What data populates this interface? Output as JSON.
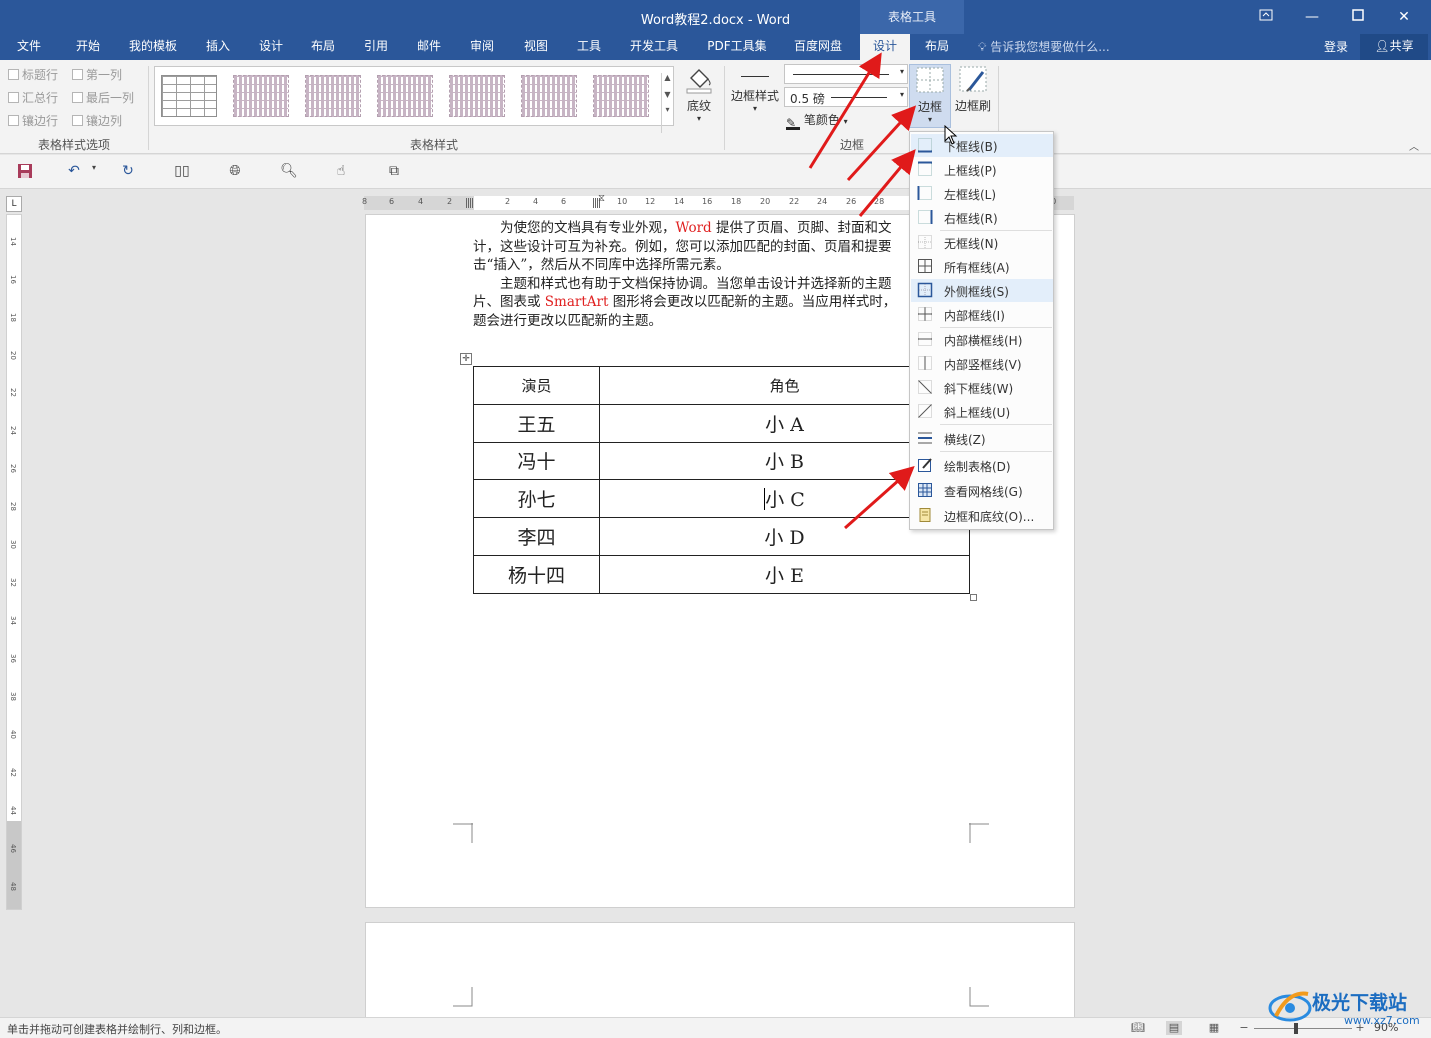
{
  "window": {
    "title": "Word教程2.docx - Word",
    "context_tab_header": "表格工具",
    "controls": [
      "ribbon-display-icon",
      "minimize-icon",
      "maximize-icon",
      "close-icon"
    ]
  },
  "tabs": [
    "文件",
    "开始",
    "我的模板",
    "插入",
    "设计",
    "布局",
    "引用",
    "邮件",
    "审阅",
    "视图",
    "工具",
    "开发工具",
    "PDF工具集",
    "百度网盘",
    "设计",
    "布局"
  ],
  "active_tab_index": 14,
  "tell_me": "告诉我您想要做什么...",
  "login": "登录",
  "share": "共享",
  "ribbon": {
    "table_style_options": {
      "label": "表格样式选项",
      "checkboxes": [
        "标题行",
        "第一列",
        "汇总行",
        "最后一列",
        "镶边行",
        "镶边列"
      ]
    },
    "table_styles": {
      "label": "表格样式"
    },
    "shading": "底纹",
    "borders_group": {
      "label": "边框",
      "border_styles": "边框样式",
      "pen_weight": "0.5 磅",
      "pen_color": "笔颜色",
      "borders": "边框",
      "border_painter": "边框刷"
    }
  },
  "hruler_ticks": [
    "8",
    "6",
    "4",
    "2",
    "2",
    "4",
    "6",
    "10",
    "12",
    "14",
    "16",
    "18",
    "20",
    "22",
    "24",
    "26",
    "28",
    "30"
  ],
  "vruler_ticks": [
    "14",
    "16",
    "18",
    "20",
    "22",
    "24",
    "26",
    "28",
    "30",
    "32",
    "34",
    "36",
    "38",
    "40",
    "42",
    "44",
    "46",
    "48"
  ],
  "document": {
    "para1": [
      "为使您的文档具有专业外观，",
      "Word",
      " 提供了页眉、页脚、封面和文",
      "计，这些设计可互为补充。例如，您可以添加匹配的封面、页眉和提要",
      "击“插入”，然后从不同库中选择所需元素。"
    ],
    "para2": [
      "主题和样式也有助于文档保持协调。当您单击设计并选择新的主题",
      "片、图表或 ",
      "SmartArt",
      " 图形将会更改以匹配新的主题。当应用样式时，",
      "题会进行更改以匹配新的主题。"
    ],
    "table": {
      "headers": [
        "演员",
        "角色"
      ],
      "rows": [
        [
          "王五",
          "小 A"
        ],
        [
          "冯十",
          "小 B"
        ],
        [
          "孙七",
          "小 C"
        ],
        [
          "李四",
          "小 D"
        ],
        [
          "杨十四",
          "小 E"
        ]
      ]
    }
  },
  "border_menu": {
    "items": [
      "下框线(B)",
      "上框线(P)",
      "左框线(L)",
      "右框线(R)",
      "无框线(N)",
      "所有框线(A)",
      "外侧框线(S)",
      "内部框线(I)",
      "内部横框线(H)",
      "内部竖框线(V)",
      "斜下框线(W)",
      "斜上框线(U)",
      "横线(Z)",
      "绘制表格(D)",
      "查看网格线(G)",
      "边框和底纹(O)..."
    ]
  },
  "status": {
    "text": "单击并拖动可创建表格并绘制行、列和边框。",
    "zoom": "90%"
  },
  "watermark": {
    "brand": "极光下载站",
    "url": "www.xz7.com"
  },
  "colors": {
    "title_bar": "#2b579a",
    "ribbon_bg": "#f3f3f3",
    "annotation_arrow": "#e01a1a",
    "doc_red_text": "#e02020"
  }
}
